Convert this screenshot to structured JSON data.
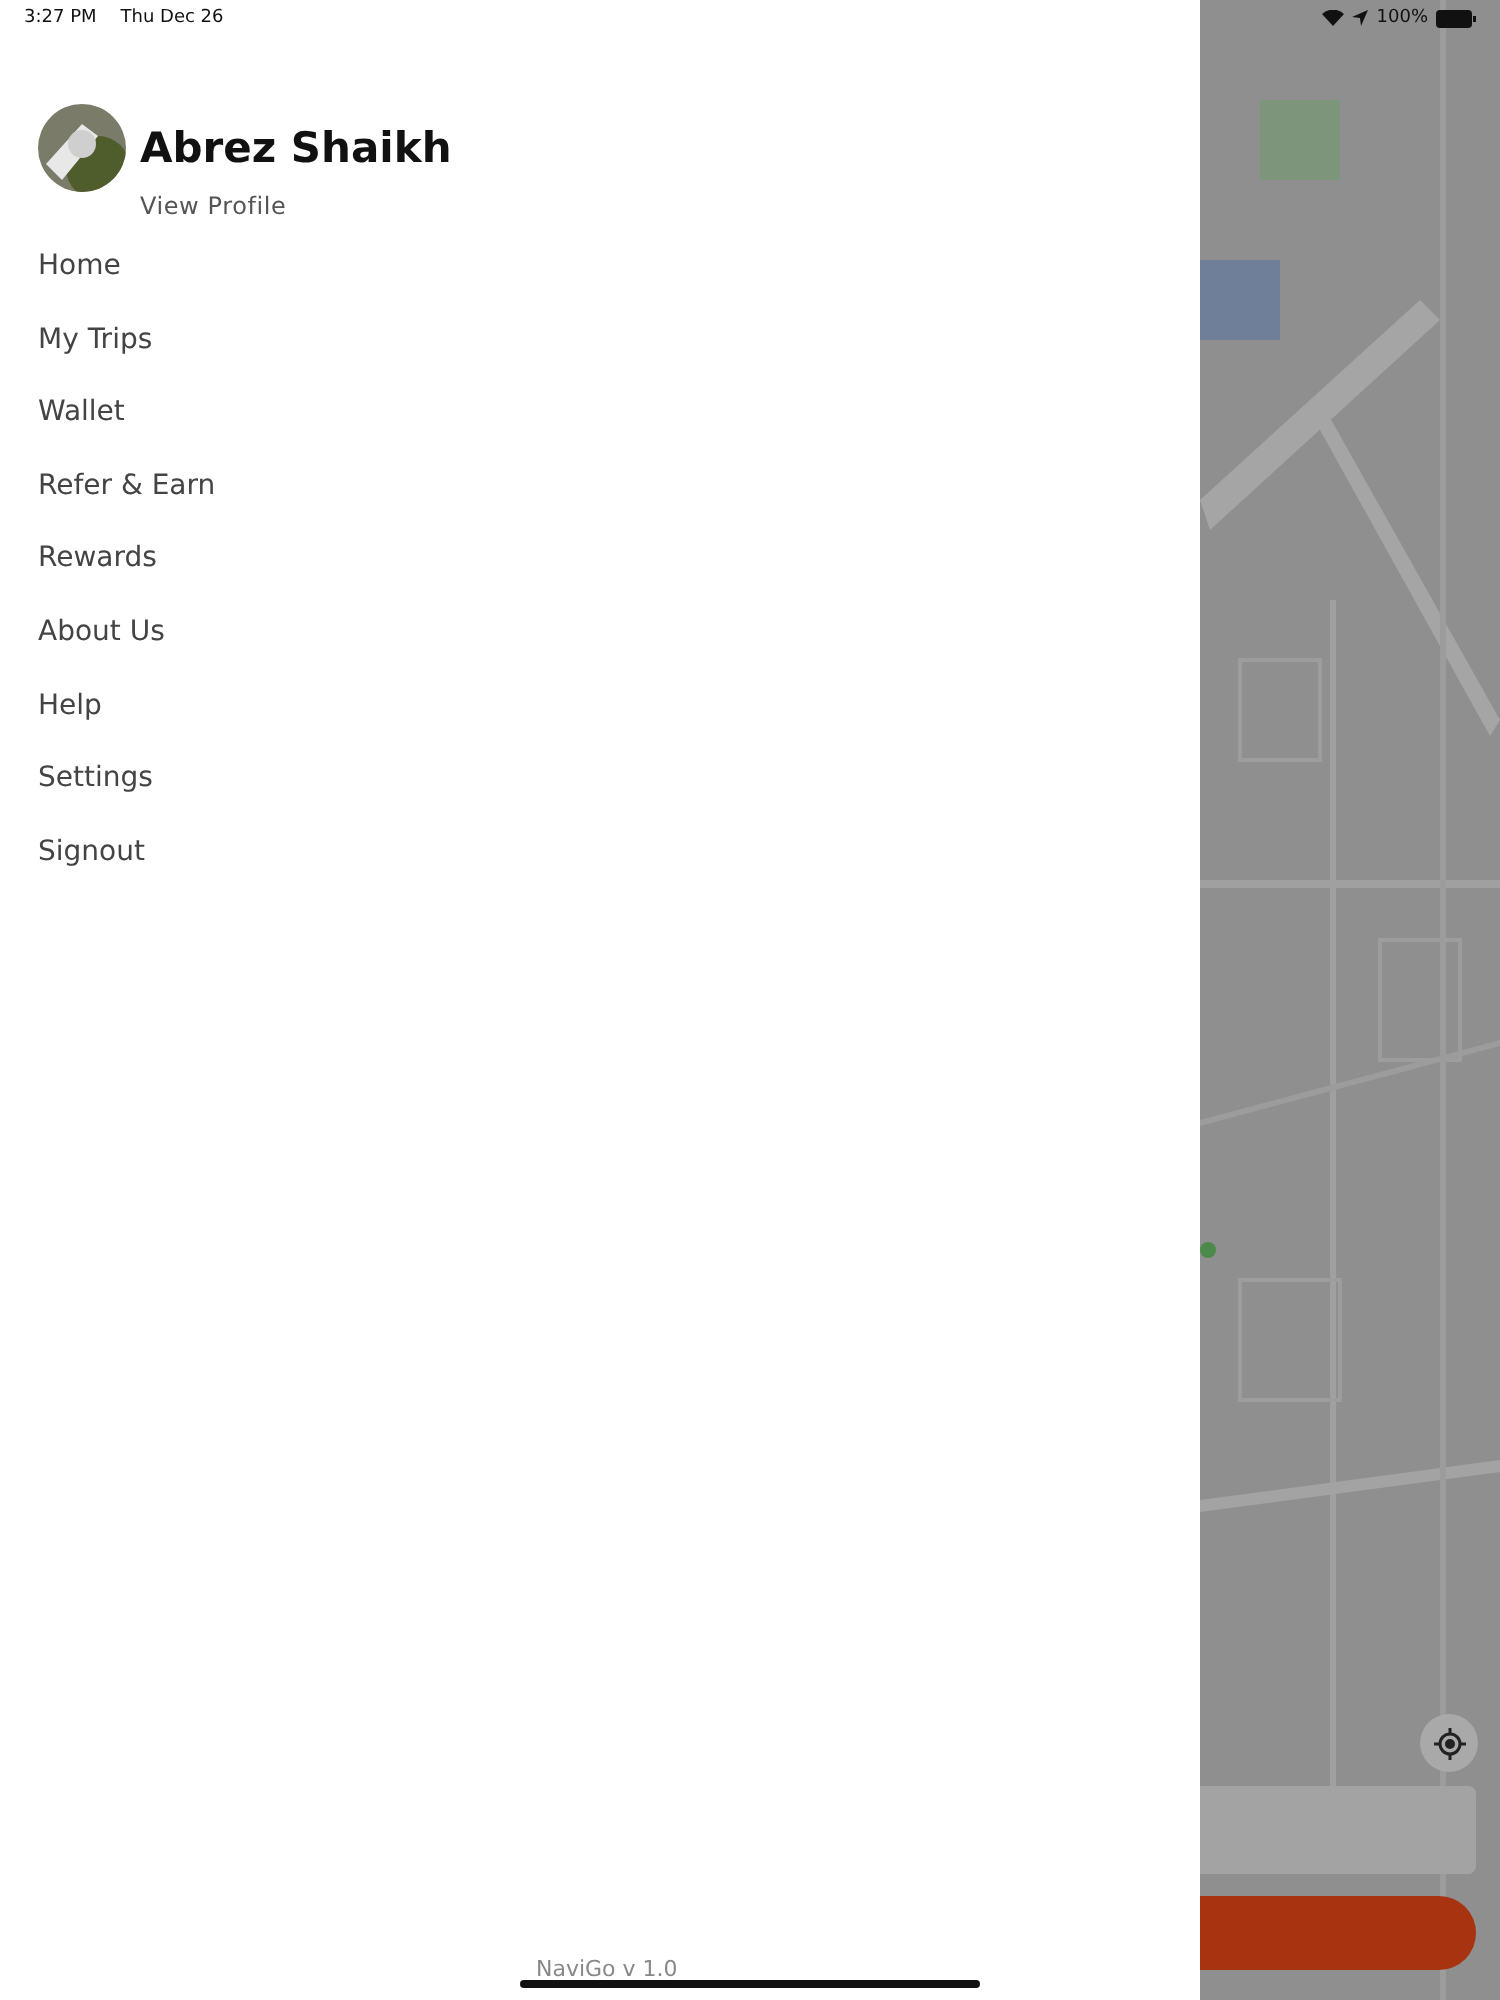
{
  "status_bar": {
    "time": "3:27 PM",
    "date": "Thu Dec 26",
    "battery": "100%"
  },
  "profile": {
    "name": "Abrez Shaikh",
    "link": "View Profile"
  },
  "menu": [
    {
      "label": "Home"
    },
    {
      "label": "My Trips"
    },
    {
      "label": "Wallet"
    },
    {
      "label": "Refer & Earn"
    },
    {
      "label": "Rewards"
    },
    {
      "label": "About Us"
    },
    {
      "label": "Help"
    },
    {
      "label": "Settings"
    },
    {
      "label": "Signout"
    }
  ],
  "version": "NaviGo v 1.0"
}
